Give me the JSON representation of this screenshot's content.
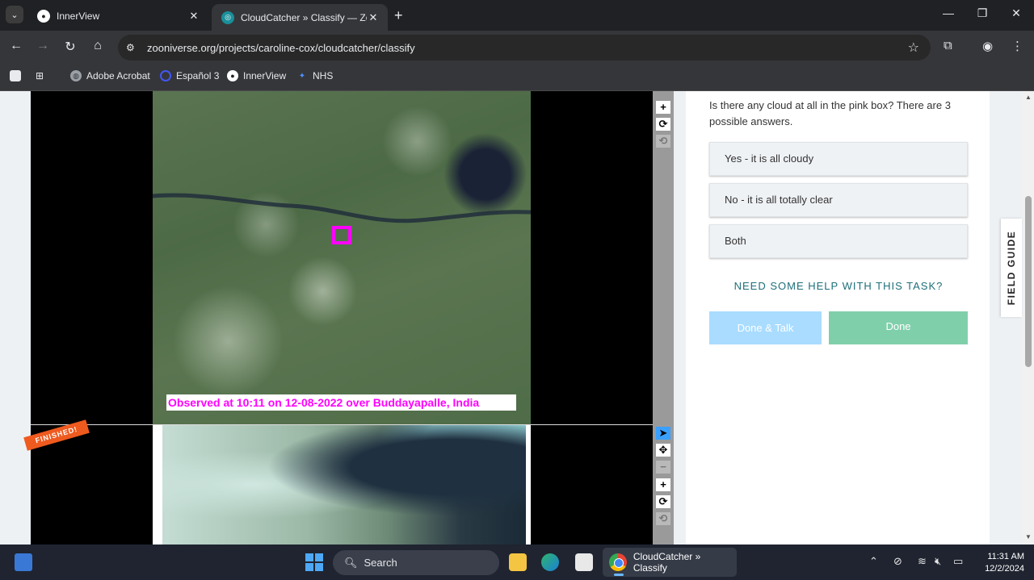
{
  "browser": {
    "tabs": [
      {
        "title": "InnerView",
        "active": false
      },
      {
        "title": "CloudCatcher » Classify — Zooniverse",
        "active": true
      }
    ],
    "new_tab": "+",
    "url": "zooniverse.org/projects/caroline-cox/cloudcatcher/classify",
    "bookmarks": [
      {
        "label": "Adobe Acrobat",
        "icon": "globe-icon"
      },
      {
        "label": "Español 3",
        "icon": "quizlet-icon"
      },
      {
        "label": "InnerView",
        "icon": "innerview-icon"
      },
      {
        "label": "NHS",
        "icon": "nhs-icon"
      }
    ]
  },
  "viewer": {
    "observed_label": "Observed at 10:11 on 12-08-2022 over Buddayapalle, India",
    "finished_badge": "FINISHED!",
    "controls_top": [
      "+",
      "⟳",
      "⟲"
    ],
    "controls_bottom": [
      "➤",
      "✥",
      "−",
      "+",
      "⟳",
      "⟲"
    ]
  },
  "task": {
    "question": "Is there any cloud at all in the pink box? There are 3 possible answers.",
    "answers": [
      "Yes - it is all cloudy",
      "No - it is all totally clear",
      "Both"
    ],
    "help_link": "NEED SOME HELP WITH THIS TASK?",
    "done_talk_label": "Done & Talk",
    "done_label": "Done"
  },
  "field_guide_label": "FIELD GUIDE",
  "taskbar": {
    "search_label": "Search",
    "active_app_label": "CloudCatcher » Classify",
    "time": "11:31 AM",
    "date": "12/2/2024"
  },
  "colors": {
    "pink_box": "#ff00ff",
    "finished_badge": "#ef5a1f",
    "done_button": "#80cfab",
    "done_talk_button": "#a9dcff",
    "help_link": "#1d6f7a"
  }
}
